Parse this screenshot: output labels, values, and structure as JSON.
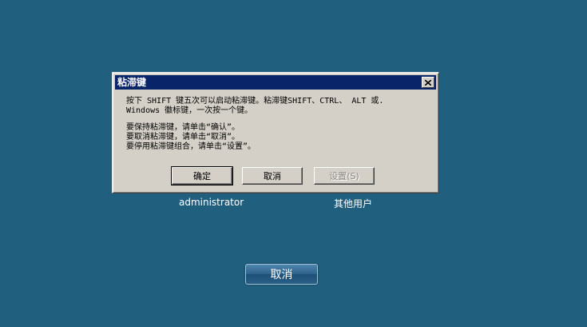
{
  "dialog": {
    "title": "粘滞键",
    "close_label": "close",
    "message_lines": [
      "按下 SHIFT 键五次可以启动粘滞键。粘滞键SHIFT、CTRL、 ALT 或.",
      "Windows 徽标键，一次按一个键。",
      "要保持粘滞键，请单击“确认”。",
      "要取消粘滞键，请单击“取消”。",
      "要停用粘滞键组合，请单击“设置”。"
    ],
    "buttons": {
      "ok": "确定",
      "cancel": "取消",
      "settings": "设置(S)"
    }
  },
  "users": {
    "admin": "administrator",
    "other": "其他用户"
  },
  "main_cancel": "取消",
  "colors": {
    "desktop_background": "#215f7e",
    "titlebar": "#0a246a",
    "dialog_face": "#d4d0c8"
  }
}
